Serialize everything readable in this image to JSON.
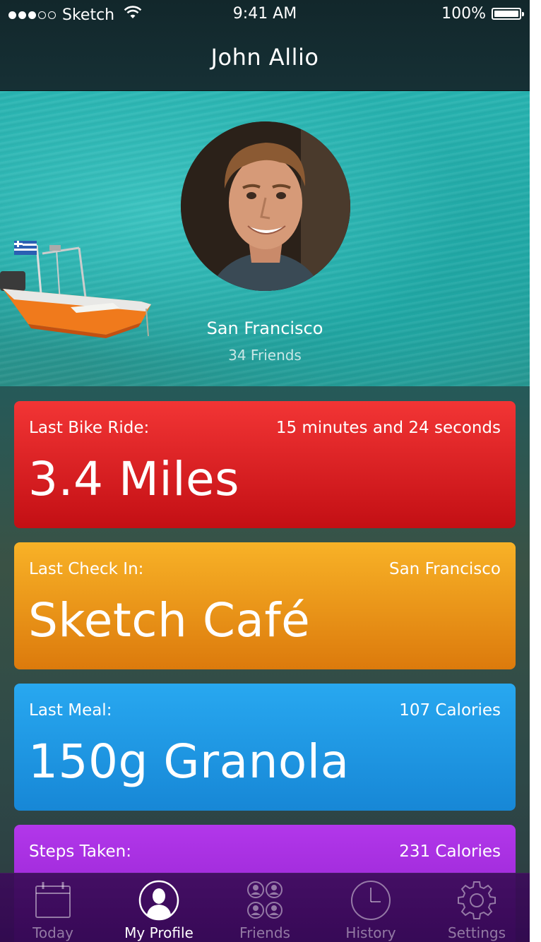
{
  "status": {
    "carrier": "Sketch",
    "time": "9:41 AM",
    "battery": "100%"
  },
  "nav": {
    "title": "John Allio"
  },
  "profile": {
    "city": "San Francisco",
    "friends": "34 Friends"
  },
  "cards": [
    {
      "label": "Last Bike Ride:",
      "detail": "15 minutes and 24 seconds",
      "value": "3.4 Miles",
      "color": "#e32427"
    },
    {
      "label": "Last Check In:",
      "detail": "San Francisco",
      "value": "Sketch Café",
      "color": "#ec9a18"
    },
    {
      "label": "Last Meal:",
      "detail": "107 Calories",
      "value": "150g Granola",
      "color": "#1f98e4"
    },
    {
      "label": "Steps Taken:",
      "detail": "231 Calories",
      "value": "",
      "color": "#a12bdc"
    }
  ],
  "tabs": [
    {
      "label": "Today",
      "icon": "calendar-icon",
      "active": false
    },
    {
      "label": "My Profile",
      "icon": "person-icon",
      "active": true
    },
    {
      "label": "Friends",
      "icon": "group-icon",
      "active": false
    },
    {
      "label": "History",
      "icon": "clock-icon",
      "active": false
    },
    {
      "label": "Settings",
      "icon": "gear-icon",
      "active": false
    }
  ]
}
